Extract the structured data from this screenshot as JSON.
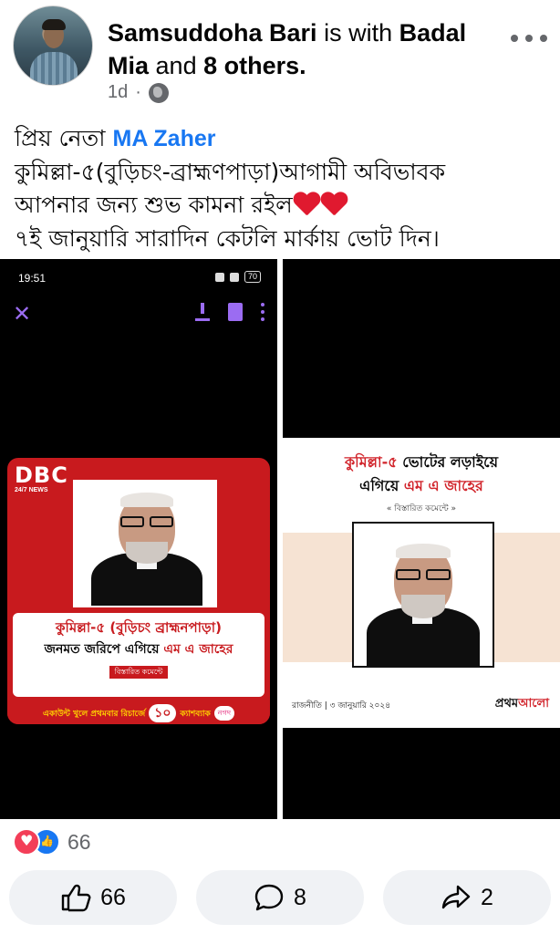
{
  "post": {
    "author": "Samsuddoha Bari",
    "with_text": "is with",
    "tagged": "Badal Mia",
    "and_text": "and",
    "others": "8 others.",
    "time": "1d",
    "separator": "·",
    "privacy_icon": "globe-icon",
    "more_icon": "more-dots-icon"
  },
  "caption": {
    "line1_prefix": "প্রিয় নেতা",
    "line1_mention": "MA Zaher",
    "line2": "কুমিল্লা-৫(বুড়িচং-ব্রাহ্মণপাড়া)আগামী অবিভাবক",
    "line3": "আপনার জন্য শুভ কামনা রইল",
    "line4": "৭ই জানুয়ারি সারাদিন কেটলি মার্কায় ভোট দিন।"
  },
  "media_left": {
    "status_time": "19:51",
    "battery": "70",
    "close_icon": "✕",
    "logo": "DBC",
    "logo_sub": "24/7 NEWS",
    "headline1": "কুমিল্লা-৫ (বুড়িচং ব্রাহ্মনপাড়া)",
    "headline2_prefix": "জনমত জরিপে এগিয়ে",
    "headline2_name": "এম এ জাহের",
    "comment_tag": "বিস্তারিত কমেন্টে",
    "ad_text": "একাউন্ট খুলে প্রথমবার রিচার্জে",
    "ad_number": "১০",
    "ad_text2": "ক্যাশব্যাক",
    "ad_brand": "নগদ"
  },
  "media_right": {
    "headline1_red": "কুমিল্লা-৫",
    "headline1_rest": "ভোটের লড়াইয়ে",
    "headline2_prefix": "এগিয়ে",
    "headline2_name": "এম এ জাহের",
    "more": "« বিস্তারিত কমেন্টে »",
    "footer_left": "রাজনীতি | ৩ জানুয়ারি ২০২৪",
    "footer_logo_a": "প্রথম",
    "footer_logo_b": "আলো"
  },
  "reactions": {
    "count": "66"
  },
  "actions": {
    "like_count": "66",
    "comment_count": "8",
    "share_count": "2"
  },
  "colors": {
    "facebook_blue": "#1877f2",
    "love_red": "#f33e58",
    "dbc_red": "#c81a1e",
    "viewer_purple": "#9b6cf2"
  }
}
